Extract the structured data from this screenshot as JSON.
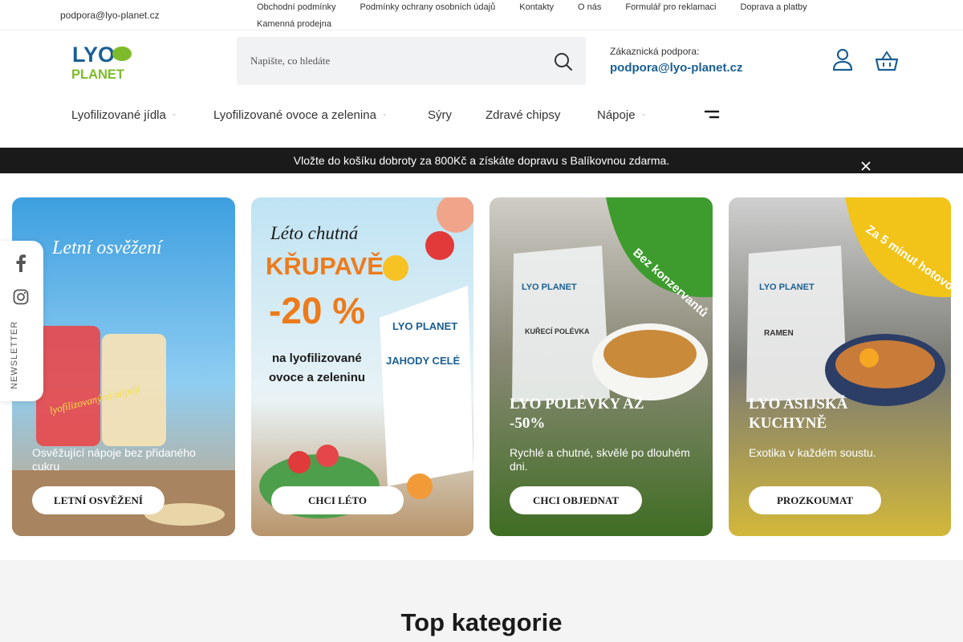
{
  "topbar": {
    "email": "podpora@lyo-planet.cz",
    "links": [
      "Obchodní podmínky",
      "Podmínky ochrany osobních údajů",
      "Kontakty",
      "O nás",
      "Formulář pro reklamaci",
      "Doprava a platby",
      "Kamenná prodejna"
    ]
  },
  "header": {
    "logo_text": {
      "line1": "LYO",
      "line2": "PLANET"
    },
    "search_placeholder": "Napište, co hledáte",
    "support_label": "Zákaznická podpora:",
    "support_email": "podpora@lyo-planet.cz",
    "icons": [
      "search-icon",
      "user-icon",
      "cart-icon"
    ]
  },
  "nav": {
    "items": [
      {
        "label": "Lyofilizované jídla",
        "has_dropdown": true
      },
      {
        "label": "Lyofilizované ovoce a zelenina",
        "has_dropdown": true
      },
      {
        "label": "Sýry",
        "has_dropdown": false
      },
      {
        "label": "Zdravé chipsy",
        "has_dropdown": false
      },
      {
        "label": "Nápoje",
        "has_dropdown": true
      }
    ],
    "caret": "▫"
  },
  "promo": {
    "text": "Vložte do košíku dobroty za 800Kč a získáte dopravu s Balíkovnou zdarma."
  },
  "banners": [
    {
      "art_text": [
        "Letní osvěžení",
        "lyofilizovanými nápoji"
      ],
      "title": "",
      "desc": "Osvěžující nápoje bez přidaného cukru",
      "button": "LETNÍ OSVĚŽENÍ"
    },
    {
      "art_text": [
        "Léto chutná",
        "KŘUPAVĚ",
        "-20 %",
        "na lyofilizované",
        "ovoce a zeleninu",
        "LYO PLANET",
        "JAHODY CELÉ"
      ],
      "title": "",
      "desc": "",
      "button": "CHCI LÉTO"
    },
    {
      "art_text": [
        "Bez konzervantů",
        "LYO PLANET",
        "KUŘECÍ POLÉVKA"
      ],
      "title": "LYO POLÉVKY AŽ -50%",
      "desc": "Rychlé a chutné, skvělé po dlouhém dni.",
      "button": "CHCI OBJEDNAT"
    },
    {
      "art_text": [
        "Za 5 minut hotovo",
        "LYO PLANET",
        "RAMEN"
      ],
      "title": "LYO ASIJSKÁ KUCHYNĚ",
      "desc": "Exotika v každém soustu.",
      "button": "PROZKOUMAT"
    }
  ],
  "social": {
    "newsletter_label": "NEWSLETTER",
    "icons": [
      "facebook-icon",
      "instagram-icon"
    ]
  },
  "section": {
    "title": "Top kategorie"
  },
  "colors": {
    "brand_blue": "#1a5f93",
    "brand_green": "#7dbb2a",
    "promo_bg": "#1a1a1a",
    "badge_green": "#3e9c2e",
    "badge_yellow": "#f2c318"
  }
}
